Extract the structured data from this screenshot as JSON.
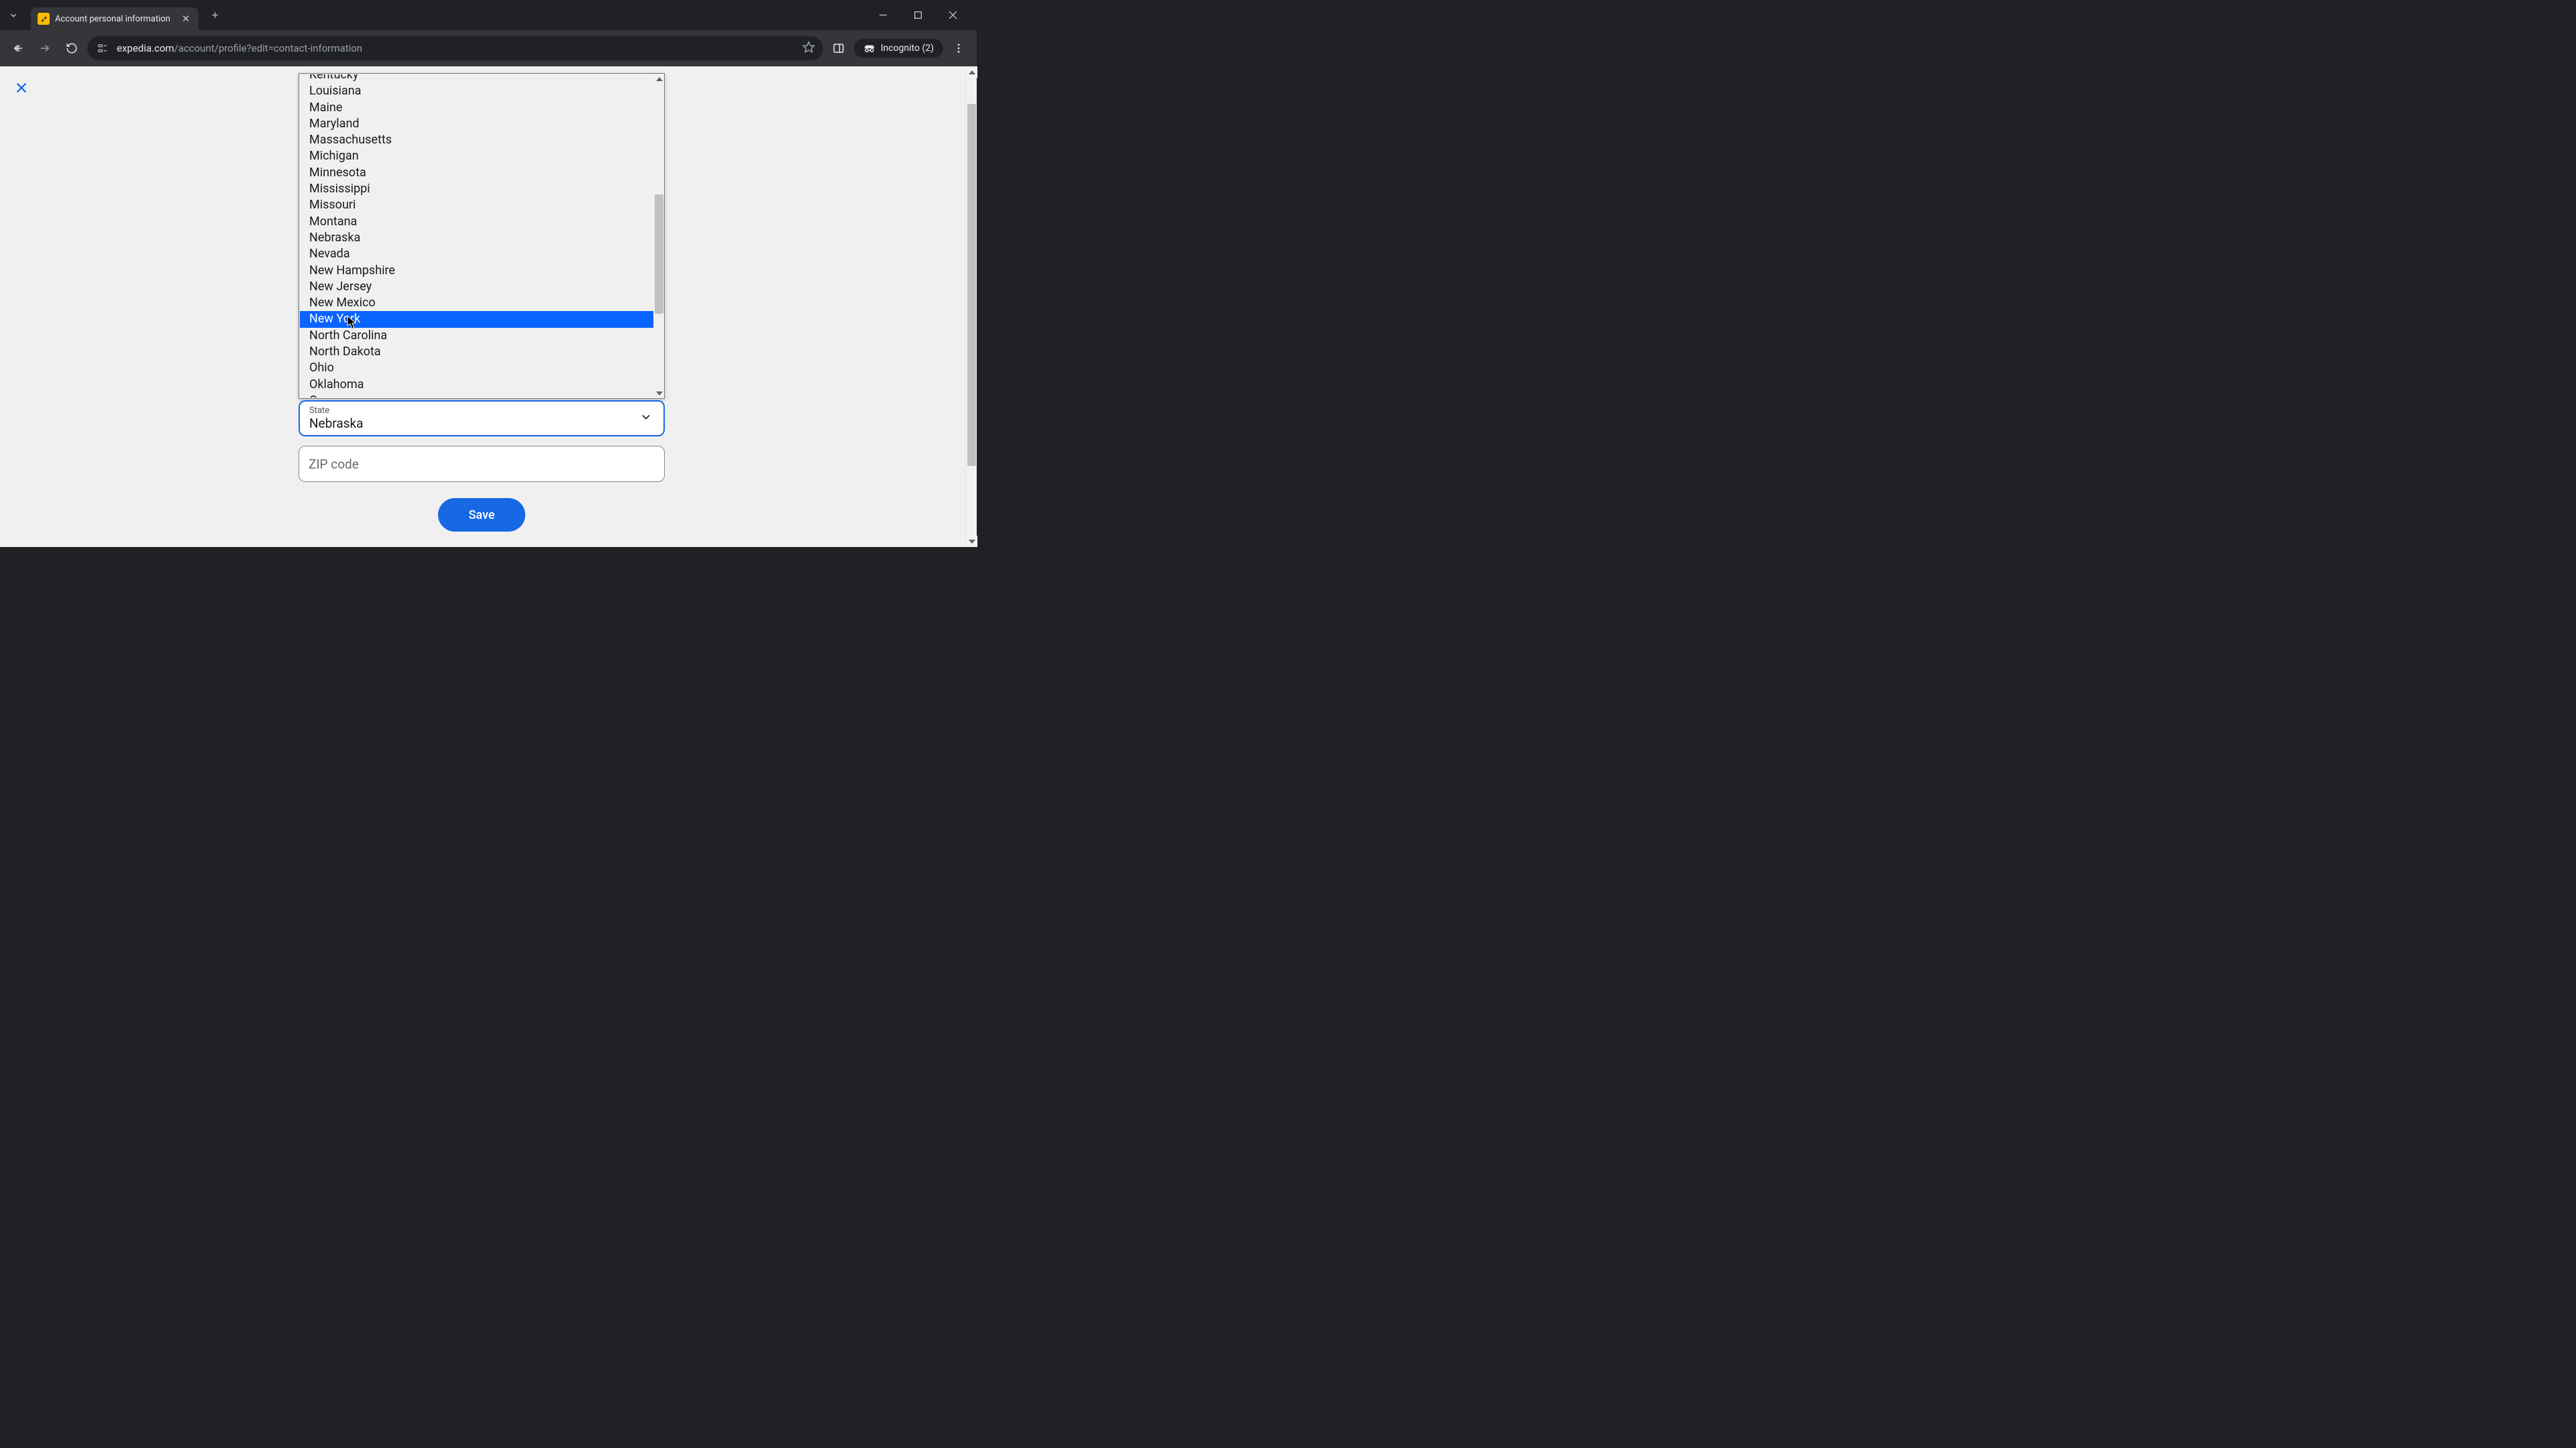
{
  "browser": {
    "tab_title": "Account personal information",
    "url_host": "expedia.com",
    "url_path": "/account/profile?edit=contact-information",
    "incognito_label": "Incognito (2)"
  },
  "modal": {
    "close_label": "✕"
  },
  "state_dropdown": {
    "label": "State",
    "selected": "Nebraska",
    "highlighted_index": 15,
    "options": [
      "Kentucky",
      "Louisiana",
      "Maine",
      "Maryland",
      "Massachusetts",
      "Michigan",
      "Minnesota",
      "Mississippi",
      "Missouri",
      "Montana",
      "Nebraska",
      "Nevada",
      "New Hampshire",
      "New Jersey",
      "New Mexico",
      "New York",
      "North Carolina",
      "North Dakota",
      "Ohio",
      "Oklahoma",
      "O"
    ]
  },
  "zip": {
    "placeholder": "ZIP code",
    "value": ""
  },
  "actions": {
    "save": "Save"
  }
}
